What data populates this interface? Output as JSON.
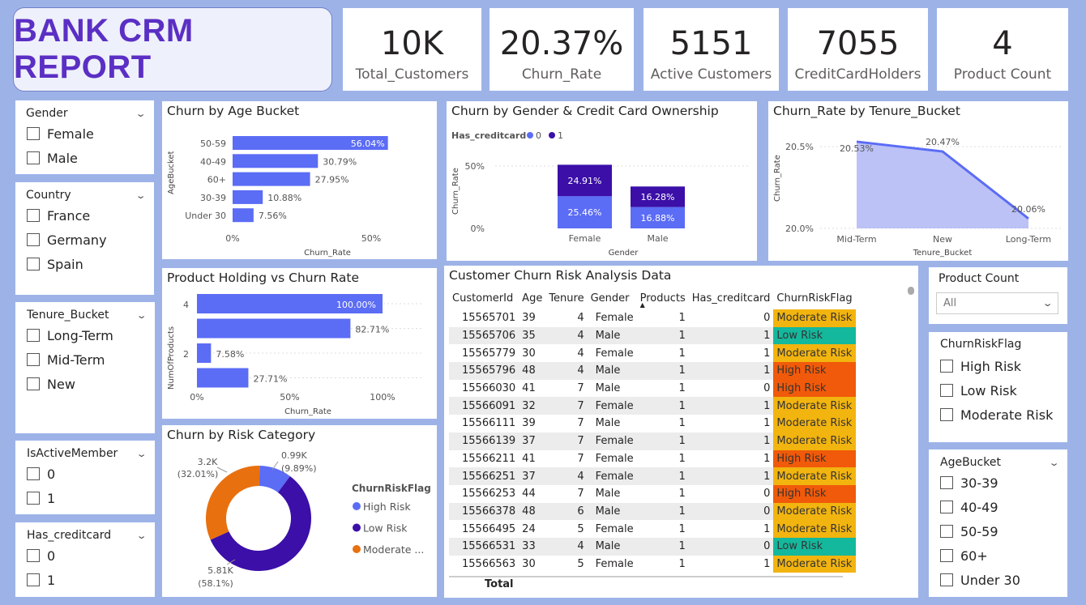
{
  "report_title": "BANK CRM REPORT",
  "kpis": [
    {
      "value": "10K",
      "label": "Total_Customers"
    },
    {
      "value": "20.37%",
      "label": "Churn_Rate"
    },
    {
      "value": "5151",
      "label": "Active Customers"
    },
    {
      "value": "7055",
      "label": "CreditCardHolders"
    },
    {
      "value": "4",
      "label": "Product Count"
    }
  ],
  "slicers": {
    "gender": {
      "title": "Gender",
      "options": [
        "Female",
        "Male"
      ]
    },
    "country": {
      "title": "Country",
      "options": [
        "France",
        "Germany",
        "Spain"
      ]
    },
    "tenure": {
      "title": "Tenure_Bucket",
      "options": [
        "Long-Term",
        "Mid-Term",
        "New"
      ]
    },
    "active": {
      "title": "IsActiveMember",
      "options": [
        "0",
        "1"
      ]
    },
    "creditcard": {
      "title": "Has_creditcard",
      "options": [
        "0",
        "1"
      ]
    },
    "product_count": {
      "title": "Product Count",
      "value": "All"
    },
    "riskflag": {
      "title": "ChurnRiskFlag",
      "options": [
        "High Risk",
        "Low Risk",
        "Moderate Risk"
      ]
    },
    "agebucket": {
      "title": "AgeBucket",
      "options": [
        "30-39",
        "40-49",
        "50-59",
        "60+",
        "Under 30"
      ]
    }
  },
  "age_chart": {
    "title": "Churn by Age Bucket",
    "ylabel": "AgeBucket",
    "xlabel": "Churn_Rate",
    "ticks": [
      "0%",
      "50%"
    ],
    "bars": [
      {
        "label": "50-59",
        "value": 56.04,
        "text": "56.04%"
      },
      {
        "label": "40-49",
        "value": 30.79,
        "text": "30.79%"
      },
      {
        "label": "60+",
        "value": 27.95,
        "text": "27.95%"
      },
      {
        "label": "30-39",
        "value": 10.88,
        "text": "10.88%"
      },
      {
        "label": "Under 30",
        "value": 7.56,
        "text": "7.56%"
      }
    ]
  },
  "gender_chart": {
    "title": "Churn by Gender & Credit Card Ownership",
    "legend_title": "Has_creditcard",
    "legend": [
      "0",
      "1"
    ],
    "ylabel": "Churn_Rate",
    "xlabel": "Gender",
    "ticks": [
      "50%",
      "0%"
    ],
    "groups": [
      {
        "label": "Female",
        "v0": 25.46,
        "v1": 24.91,
        "t0": "25.46%",
        "t1": "24.91%"
      },
      {
        "label": "Male",
        "v0": 16.88,
        "v1": 16.28,
        "t0": "16.88%",
        "t1": "16.28%"
      }
    ]
  },
  "tenure_chart": {
    "title": "Churn_Rate by Tenure_Bucket",
    "ylabel": "Churn_Rate",
    "xlabel": "Tenure_Bucket",
    "ticks": [
      "20.5%",
      "20.0%"
    ],
    "points": [
      {
        "label": "Mid-Term",
        "value": 20.53,
        "text": "20.53%"
      },
      {
        "label": "New",
        "value": 20.47,
        "text": "20.47%"
      },
      {
        "label": "Long-Term",
        "value": 20.06,
        "text": "20.06%"
      }
    ]
  },
  "product_chart": {
    "title": "Product Holding vs Churn Rate",
    "ylabel": "NumOfProducts",
    "xlabel": "Churn_Rate",
    "ticks": [
      "0%",
      "50%",
      "100%"
    ],
    "bars": [
      {
        "label": "4",
        "value": 100.0,
        "text": "100.00%"
      },
      {
        "label": "",
        "value": 82.71,
        "text": "82.71%"
      },
      {
        "label": "2",
        "value": 7.58,
        "text": "7.58%"
      },
      {
        "label": "",
        "value": 27.71,
        "text": "27.71%"
      }
    ]
  },
  "risk_chart": {
    "title": "Churn by Risk Category",
    "legend_title": "ChurnRiskFlag",
    "slices": [
      {
        "name": "High Risk",
        "value": 0.99,
        "text1": "0.99K",
        "text2": "(9.89%)",
        "color": "#5b6cf5"
      },
      {
        "name": "Low Risk",
        "value": 5.81,
        "text1": "5.81K",
        "text2": "(58.1%)",
        "color": "#3b0fa8"
      },
      {
        "name": "Moderate ...",
        "value": 3.2,
        "text1": "3.2K",
        "text2": "(32.01%)",
        "color": "#e8700f"
      }
    ]
  },
  "table": {
    "title": "Customer Churn Risk Analysis Data",
    "columns": [
      "CustomerId",
      "Age",
      "Tenure",
      "Gender",
      "Products",
      "Has_creditcard",
      "ChurnRiskFlag"
    ],
    "rows": [
      [
        "15565701",
        "39",
        "4",
        "Female",
        "1",
        "0",
        "Moderate Risk"
      ],
      [
        "15565706",
        "35",
        "4",
        "Male",
        "1",
        "1",
        "Low Risk"
      ],
      [
        "15565779",
        "30",
        "4",
        "Female",
        "1",
        "1",
        "Moderate Risk"
      ],
      [
        "15565796",
        "48",
        "4",
        "Male",
        "1",
        "1",
        "High Risk"
      ],
      [
        "15566030",
        "41",
        "7",
        "Male",
        "1",
        "0",
        "High Risk"
      ],
      [
        "15566091",
        "32",
        "7",
        "Female",
        "1",
        "1",
        "Moderate Risk"
      ],
      [
        "15566111",
        "39",
        "7",
        "Male",
        "1",
        "1",
        "Moderate Risk"
      ],
      [
        "15566139",
        "37",
        "7",
        "Female",
        "1",
        "1",
        "Moderate Risk"
      ],
      [
        "15566211",
        "41",
        "7",
        "Female",
        "1",
        "1",
        "High Risk"
      ],
      [
        "15566251",
        "37",
        "4",
        "Female",
        "1",
        "1",
        "Moderate Risk"
      ],
      [
        "15566253",
        "44",
        "7",
        "Male",
        "1",
        "0",
        "High Risk"
      ],
      [
        "15566378",
        "48",
        "6",
        "Male",
        "1",
        "0",
        "Moderate Risk"
      ],
      [
        "15566495",
        "24",
        "5",
        "Female",
        "1",
        "1",
        "Moderate Risk"
      ],
      [
        "15566531",
        "33",
        "4",
        "Male",
        "1",
        "0",
        "Low Risk"
      ],
      [
        "15566563",
        "30",
        "5",
        "Female",
        "1",
        "1",
        "Moderate Risk"
      ]
    ],
    "total_label": "Total",
    "flag_colors": {
      "Moderate Risk": "#f2b40f",
      "Low Risk": "#14b89c",
      "High Risk": "#f05a0a"
    }
  },
  "colors": {
    "bar": "#5b6cf5",
    "dark": "#3b0fa8",
    "area": "#bcc2f6"
  }
}
